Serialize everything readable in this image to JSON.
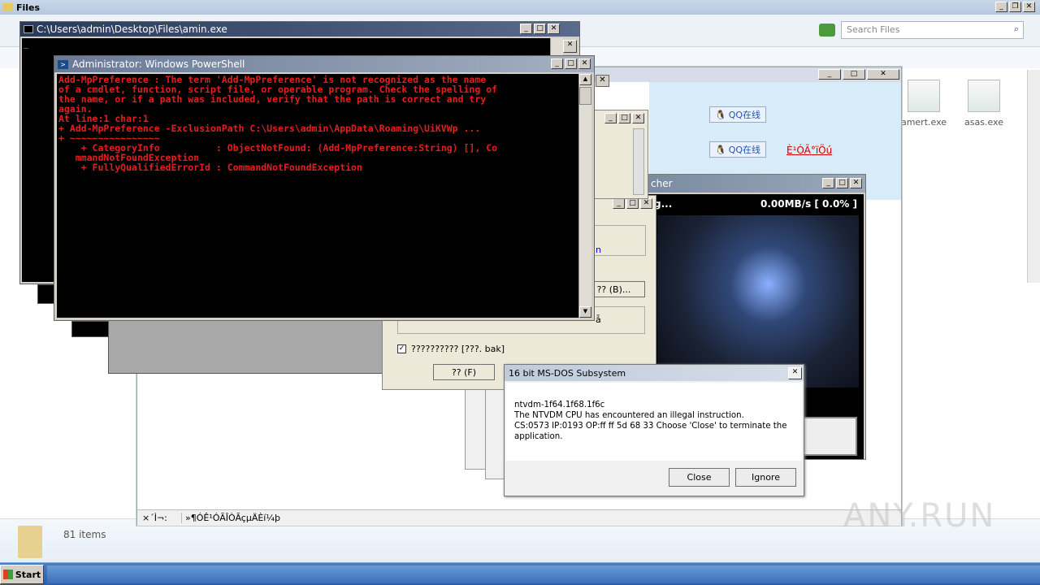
{
  "explorer": {
    "title": "Files",
    "search_placeholder": "Search Files",
    "status_count": "81 items",
    "files": [
      {
        "name": "amert.exe"
      },
      {
        "name": "asas.exe"
      }
    ]
  },
  "cmd": {
    "title": "C:\\Users\\admin\\Desktop\\Files\\amin.exe"
  },
  "ps": {
    "title": "Administrator: Windows PowerShell",
    "lines": [
      "Add-MpPreference : The term 'Add-MpPreference' is not recognized as the name",
      "of a cmdlet, function, script file, or operable program. Check the spelling of",
      "the name, or if a path was included, verify that the path is correct and try",
      "again.",
      "At line:1 char:1",
      "+ Add-MpPreference -ExclusionPath C:\\Users\\admin\\AppData\\Roaming\\UiKVWp ...",
      "+ ~~~~~~~~~~~~~~~~",
      "    + CategoryInfo          : ObjectNotFound: (Add-MpPreference:String) [], Co",
      "   mmandNotFoundException",
      "    + FullyQualifiedErrorId : CommandNotFoundException"
    ]
  },
  "qq": {
    "label1": "QQ在线",
    "label2": "QQ在线",
    "link": "È¹ÓÃ°ïÖú"
  },
  "launcher": {
    "title": "cher",
    "status": "g...",
    "speed": "0.00MB/s [ 0.0% ]"
  },
  "setup": {
    "btn1": "?? (B)...",
    "check_label": "?????????? [???. bak]",
    "btn2": "?? (F)",
    "frag": "n",
    "frag2": "ǡ"
  },
  "statusbar": {
    "left": "×´Ì¬:",
    "text": "»¶Ó­Ê¹ÓÃÎÒÃçµÄÈí¼þ"
  },
  "ntvdm": {
    "title": "16 bit MS-DOS Subsystem",
    "line1": "ntvdm-1f64.1f68.1f6c",
    "line2": "The NTVDM CPU has encountered an illegal instruction.",
    "line3": "CS:0573 IP:0193 OP:ff ff 5d 68 33 Choose 'Close' to terminate the application.",
    "close": "Close",
    "ignore": "Ignore"
  },
  "taskbar": {
    "start": "Start"
  },
  "watermark": "ANY.RUN"
}
